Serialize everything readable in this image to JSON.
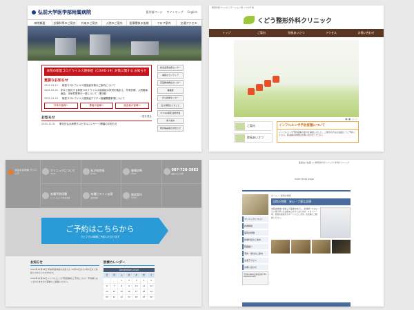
{
  "panel1": {
    "hospital_name": "弘前大学医学部附属病院",
    "header_links": [
      "医学部ページ",
      "サイトマップ",
      "English"
    ],
    "nav": [
      "病院概要",
      "診療科等のご案内",
      "外来のご案内",
      "入院のご案内",
      "医療関係の皆様",
      "フロア案内",
      "交通アクセス"
    ],
    "alert_title": "本院の新型コロナウイルス感染症（COVID-19）対策に関する お知らせ",
    "important_label": "重要なお知らせ",
    "news_lines": [
      {
        "date": "2021.02.11",
        "text": "新型コロナウイルス感染症対策のご案内について"
      },
      {
        "date": "2021.02.01",
        "text": "刻々と変化する新型コロナウイルス感染症の状況を踏まえ、外来診療、入院患者面会、手術件数等の一部について（第2報）"
      },
      {
        "date": "2021.01.25",
        "text": "新型コロナウイルス感染症ワクチン接種関連事項について"
      }
    ],
    "buttons": [
      "外来の皆様へ",
      "患者の皆様へ",
      "面会者の皆様へ"
    ],
    "news_title": "お知らせ",
    "news_more": "一覧を見る",
    "latest_news": {
      "date": "2020.12.31",
      "text": "第1回 弘大病院ホスピタルコンサート開催のお知らせ"
    },
    "side_links": [
      "総合患者支援センター",
      "病院ボランティア",
      "高度救命救急センター",
      "看護部",
      "がん診療センター",
      "弘大病院のできごと",
      "ICT-GR病院 連携学会",
      "求人案内",
      "研究等実施のお知らせ"
    ]
  },
  "panel2": {
    "top_text": "整形外科ブリハビリテーション科 リウマチ科",
    "clinic_name": "くどう整形外科クリニック",
    "nav": [
      "トップ",
      "ご案内",
      "院長あいさつ",
      "アクセス",
      "お問い合わせ"
    ],
    "dots": "● ● ○ ○",
    "cards": [
      "ご案内",
      "院長あいさつ"
    ],
    "info_title": "インフルエンザ予防接種について",
    "info_body": "インフルエンザ予防接種の受付を開始しました。ご希望の方はお電話にてご予約ください。料金等の詳細はお問い合わせください。"
  },
  "panel3": {
    "logo_text": "まるなる内科 クリニック",
    "cells": [
      {
        "label": "クリニックについて",
        "sub": "About"
      },
      {
        "label": "私が私院長",
        "sub": "Doctor"
      },
      {
        "label": "健康診断",
        "sub": "Check"
      },
      {
        "label": "087-728-3883",
        "sub": "電話でのご予約"
      },
      {
        "label": "各種予防接種",
        "sub": "インフルエンザ 肺炎球菌"
      },
      {
        "label": "各種ビタミン点滴",
        "sub": "疲労回復"
      },
      {
        "label": "施設案内",
        "sub": "Facility"
      },
      {
        "label": "",
        "sub": ""
      }
    ],
    "reserve_big": "ご予約はこちらから",
    "reserve_small": "ウェブで24時間ご予約いただけます",
    "news_title": "お知らせ",
    "news": [
      "2020年12月28日 年末年始休診のお知らせ 12月29日から1月3日まで休診とさせていただきます。",
      "2020年11月30日 インフルエンザ予防接種のご予約について 予約制となっておりますので事前にご連絡ください。"
    ],
    "calendar_title": "診療カレンダー",
    "calendar_month": "December 2020",
    "calendar_days": [
      "日",
      "月",
      "火",
      "水",
      "木",
      "金",
      "土",
      "",
      "",
      "1",
      "2",
      "3",
      "4",
      "5",
      "6",
      "7",
      "8",
      "9",
      "10",
      "11",
      "12",
      "13",
      "14",
      "15",
      "16",
      "17",
      "18",
      "19",
      "20",
      "21",
      "22",
      "23",
      "24",
      "25",
      "26"
    ]
  },
  "panel4": {
    "top_text": "医療法人社団 ○○整形外科クリニック 外科クリニック",
    "clinic_name": "Insert text page",
    "side_links": [
      "クリニックについて",
      "診療時間",
      "医院の特徴",
      "診療科目のご案内",
      "院長紹介",
      "予約・受付のご案内",
      "交通アクセス",
      "お問い合わせ"
    ],
    "address": "〒000-0000 住所表記例 TEL 00-0000-0000",
    "crumb": "ホーム > 当院の特徴",
    "title": "当院の特徴　安心・丁寧な診療",
    "body": "当院は地域に密着した医療をめざし、患者様一人ひとりに寄り添った診療を心がけております。スタッフ一同、皆様の健康をサポートいたします。お気軽にご相談ください。"
  }
}
